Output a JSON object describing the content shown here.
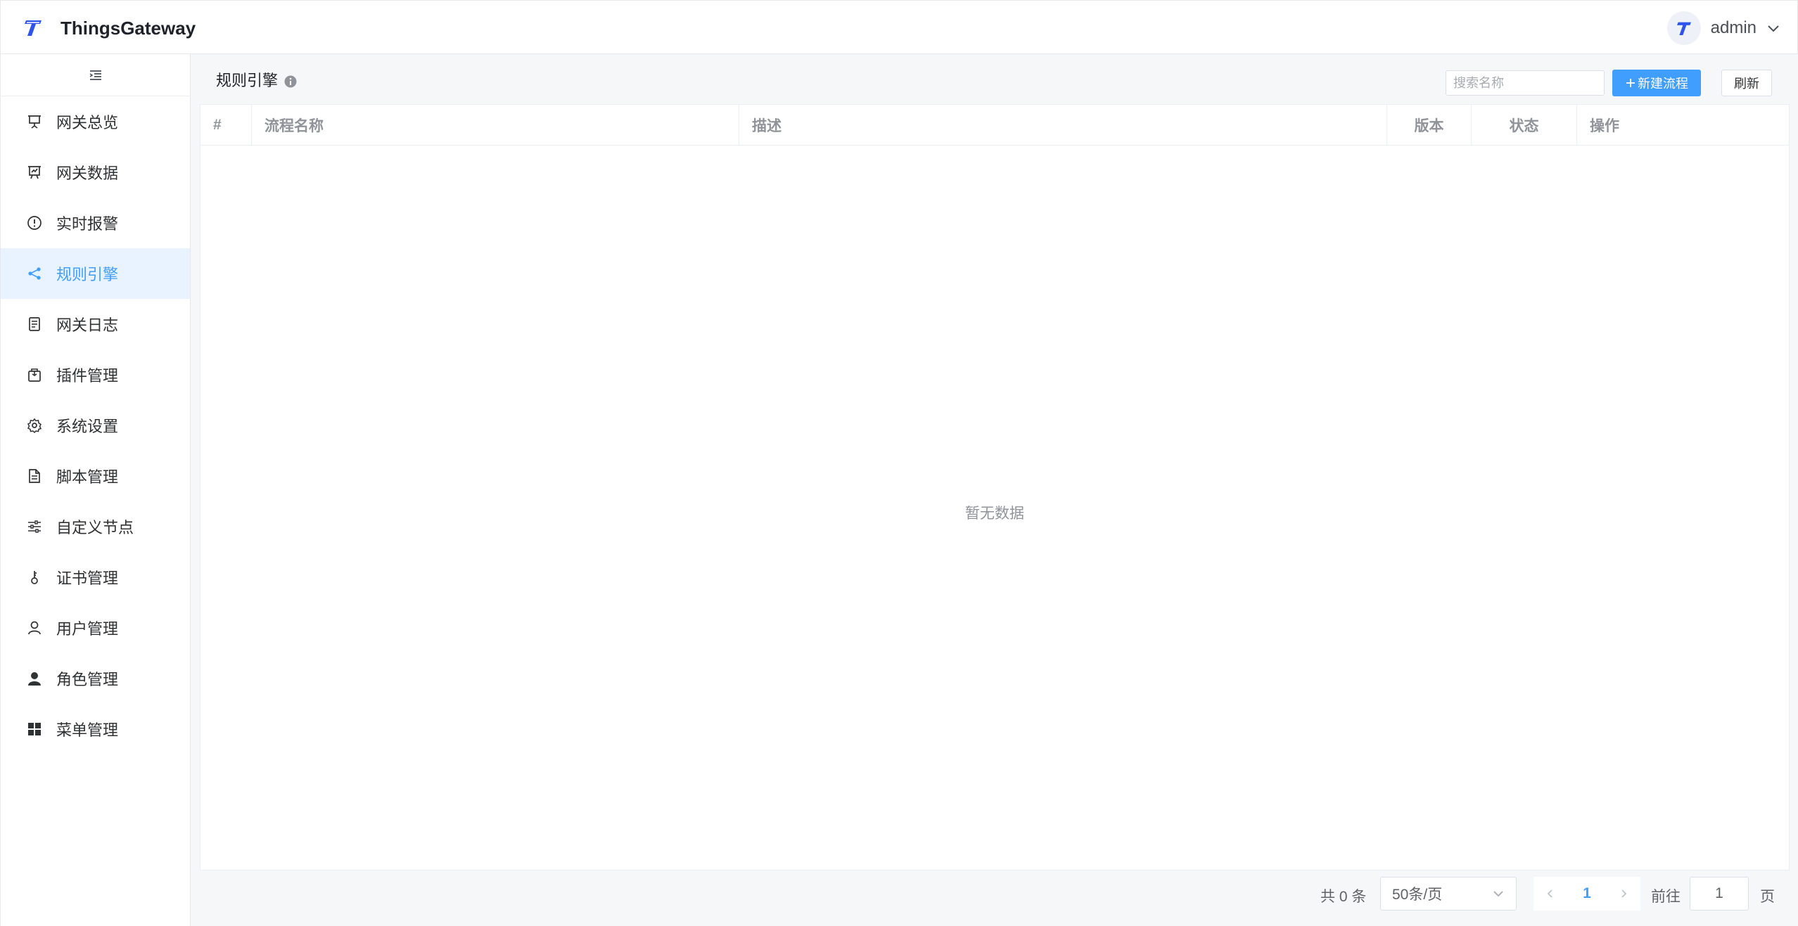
{
  "header": {
    "app_title": "ThingsGateway",
    "user": "admin",
    "logo_icon": "things-gateway-logo",
    "user_menu_icon": "chevron-down-icon"
  },
  "sidebar": {
    "collapse_icon": "menu-fold-icon",
    "items": [
      {
        "label": "网关总览",
        "icon": "presentation-icon",
        "active": false
      },
      {
        "label": "网关数据",
        "icon": "chart-board-icon",
        "active": false
      },
      {
        "label": "实时报警",
        "icon": "alert-circle-icon",
        "active": false
      },
      {
        "label": "规则引擎",
        "icon": "share-icon",
        "active": true
      },
      {
        "label": "网关日志",
        "icon": "document-list-icon",
        "active": false
      },
      {
        "label": "插件管理",
        "icon": "package-icon",
        "active": false
      },
      {
        "label": "系统设置",
        "icon": "gear-icon",
        "active": false
      },
      {
        "label": "脚本管理",
        "icon": "file-text-icon",
        "active": false
      },
      {
        "label": "自定义节点",
        "icon": "sliders-icon",
        "active": false
      },
      {
        "label": "证书管理",
        "icon": "key-icon",
        "active": false
      },
      {
        "label": "用户管理",
        "icon": "user-outline-icon",
        "active": false
      },
      {
        "label": "角色管理",
        "icon": "user-filled-icon",
        "active": false
      },
      {
        "label": "菜单管理",
        "icon": "grid-icon",
        "active": false
      }
    ]
  },
  "main": {
    "title": "规则引擎",
    "search_placeholder": "搜索名称",
    "new_button": "新建流程",
    "refresh_button": "刷新",
    "columns": [
      "#",
      "流程名称",
      "描述",
      "版本",
      "状态",
      "操作"
    ],
    "rows": [],
    "empty_text": "暂无数据"
  },
  "pagination": {
    "total": "共 0 条",
    "page_size": "50条/页",
    "current_page": "1",
    "goto_label": "前往",
    "goto_value": "1",
    "page_suffix": "页"
  },
  "colors": {
    "accent": "#409eff",
    "active_bg": "#e8f3ff"
  }
}
